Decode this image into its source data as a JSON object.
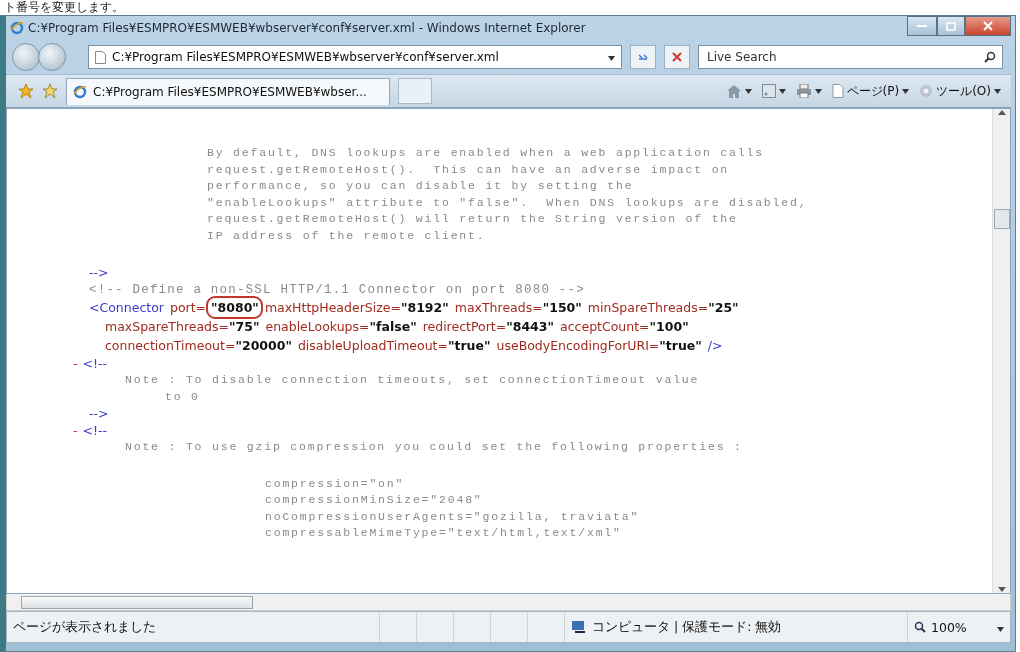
{
  "caption": "ト番号を変更します。",
  "window": {
    "title": "C:¥Program Files¥ESMPRO¥ESMWEB¥wbserver¥conf¥server.xml - Windows Internet Explorer"
  },
  "address_bar": {
    "value": "C:¥Program Files¥ESMPRO¥ESMWEB¥wbserver¥conf¥server.xml"
  },
  "search": {
    "placeholder": "Live Search"
  },
  "tabs": [
    {
      "label": "C:¥Program Files¥ESMPRO¥ESMWEB¥wbser...",
      "selected": true
    }
  ],
  "command_bar": [
    {
      "kind": "home"
    },
    {
      "kind": "feed"
    },
    {
      "kind": "print"
    },
    {
      "kind": "page",
      "label": "ページ(P)"
    },
    {
      "kind": "tools",
      "label": "ツール(O)"
    }
  ],
  "document": {
    "lines": [
      {
        "kind": "comment-body",
        "text": "By default, DNS lookups are enabled when a web application calls"
      },
      {
        "kind": "comment-body",
        "text": "request.getRemoteHost().  This can have an adverse impact on"
      },
      {
        "kind": "comment-body",
        "text": "performance, so you can disable it by setting the"
      },
      {
        "kind": "comment-body",
        "text": "\"enableLookups\" attribute to \"false\".  When DNS lookups are disabled,"
      },
      {
        "kind": "comment-body",
        "text": "request.getRemoteHost() will return the String version of the"
      },
      {
        "kind": "comment-body",
        "text": "IP address of the remote client."
      },
      {
        "kind": "gap"
      },
      {
        "kind": "markup",
        "text": "-->"
      },
      {
        "kind": "comment",
        "text": "<!--  Define a non-SSL HTTP/1.1 Connector on port 8080  -->"
      },
      {
        "kind": "element",
        "open": "<Connector",
        "close": "/>",
        "rows": [
          [
            {
              "name": "port=",
              "value": "\"8080\"",
              "circled": true
            },
            {
              "name": "maxHttpHeaderSize=",
              "value": "\"8192\"",
              "circled": false
            },
            {
              "name": "maxThreads=",
              "value": "\"150\"",
              "circled": false
            },
            {
              "name": "minSpareThreads=",
              "value": "\"25\"",
              "circled": false
            }
          ],
          [
            {
              "name": "maxSpareThreads=",
              "value": "\"75\"",
              "circled": false
            },
            {
              "name": "enableLookups=",
              "value": "\"false\"",
              "circled": false
            },
            {
              "name": "redirectPort=",
              "value": "\"8443\"",
              "circled": false
            },
            {
              "name": "acceptCount=",
              "value": "\"100\"",
              "circled": false
            }
          ],
          [
            {
              "name": "connectionTimeout=",
              "value": "\"20000\"",
              "circled": false
            },
            {
              "name": "disableUploadTimeout=",
              "value": "\"true\"",
              "circled": false
            },
            {
              "name": "useBodyEncodingForURI=",
              "value": "\"true\"",
              "circled": false
            }
          ]
        ]
      },
      {
        "kind": "toggle",
        "toggle": "-",
        "text": "<!--"
      },
      {
        "kind": "note",
        "text": "Note : To disable connection timeouts, set connectionTimeout value"
      },
      {
        "kind": "note-cont",
        "text": "to 0"
      },
      {
        "kind": "markup",
        "text": "-->"
      },
      {
        "kind": "toggle",
        "toggle": "-",
        "text": "<!--"
      },
      {
        "kind": "note",
        "text": "Note : To use gzip compression you could set the following properties :"
      },
      {
        "kind": "gap"
      },
      {
        "kind": "property",
        "text": "compression=\"on\""
      },
      {
        "kind": "property",
        "text": "compressionMinSize=\"2048\""
      },
      {
        "kind": "property",
        "text": "noCompressionUserAgents=\"gozilla, traviata\""
      },
      {
        "kind": "property",
        "text": "compressableMimeType=\"text/html,text/xml\""
      }
    ]
  },
  "status_bar": {
    "message": "ページが表示されました",
    "zone": "コンピュータ | 保護モード: 無効",
    "zoom": "100%"
  }
}
